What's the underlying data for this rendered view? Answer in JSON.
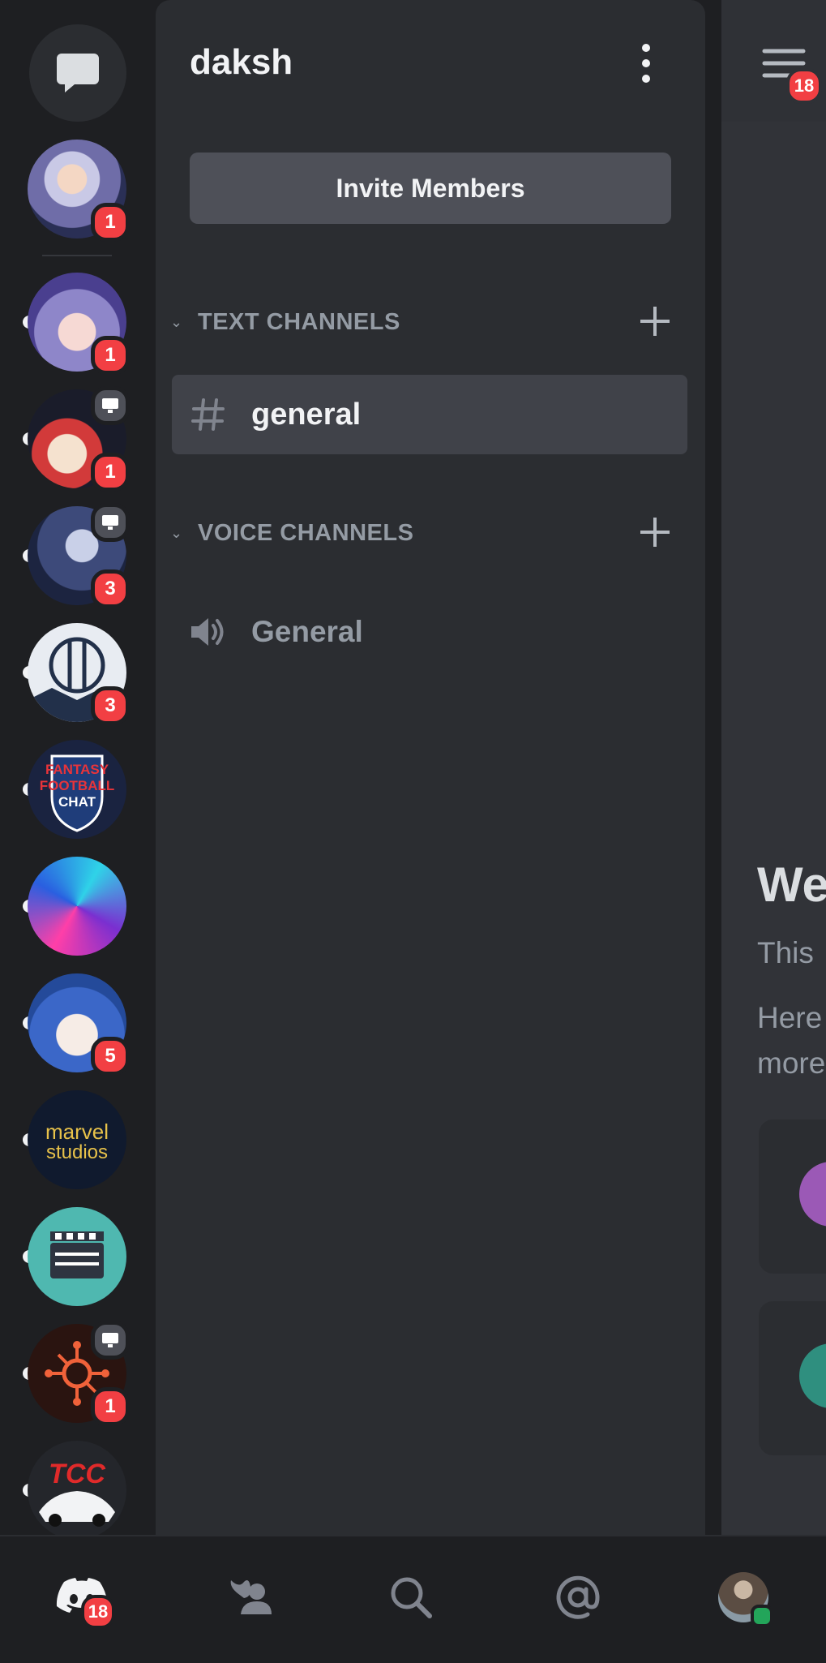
{
  "server": {
    "name": "daksh",
    "invite_label": "Invite Members"
  },
  "categories": {
    "text": {
      "label": "TEXT CHANNELS"
    },
    "voice": {
      "label": "VOICE CHANNELS"
    }
  },
  "channels": {
    "text": [
      {
        "name": "general",
        "selected": true
      }
    ],
    "voice": [
      {
        "name": "General"
      }
    ]
  },
  "rail": {
    "servers": [
      {
        "name": "anime-avatar-1",
        "badge": "1",
        "has_screen_share": false
      },
      {
        "name": "anime-avatar-2",
        "badge": "1",
        "has_screen_share": false
      },
      {
        "name": "anime-avatar-3",
        "badge": "1",
        "has_screen_share": true
      },
      {
        "name": "winter-scene",
        "badge": "3",
        "has_screen_share": true
      },
      {
        "name": "bridge-logo",
        "badge": "3",
        "has_screen_share": false
      },
      {
        "name": "fantasy-football-chat",
        "badge": "",
        "has_screen_share": false
      },
      {
        "name": "colorful-abstract",
        "badge": "",
        "has_screen_share": false
      },
      {
        "name": "blue-hair-anime",
        "badge": "5",
        "has_screen_share": false
      },
      {
        "name": "marvel-studios",
        "badge": "",
        "has_screen_share": false
      },
      {
        "name": "clapperboard",
        "badge": "",
        "has_screen_share": false
      },
      {
        "name": "orange-network",
        "badge": "1",
        "has_screen_share": true
      },
      {
        "name": "tcc-car",
        "badge": "",
        "has_screen_share": false
      }
    ],
    "server_texts": {
      "fantasy": [
        "FANTASY",
        "FOOTBALL",
        "CHAT"
      ],
      "marvel": [
        "marvel",
        "studios"
      ],
      "tcc": "TCC"
    }
  },
  "chat_peek": {
    "menu_badge": "18",
    "welcome_fragment": "We",
    "line1_fragment": "This",
    "line2_fragment": "Here",
    "line3_fragment": "more"
  },
  "bottom_nav": {
    "home_badge": "18",
    "items": [
      "home",
      "friends",
      "search",
      "mentions",
      "profile"
    ]
  },
  "colors": {
    "background": "#1e1f22",
    "panel": "#2b2d31",
    "selected": "#404249",
    "badge": "#f23f43",
    "online": "#23a55a"
  }
}
